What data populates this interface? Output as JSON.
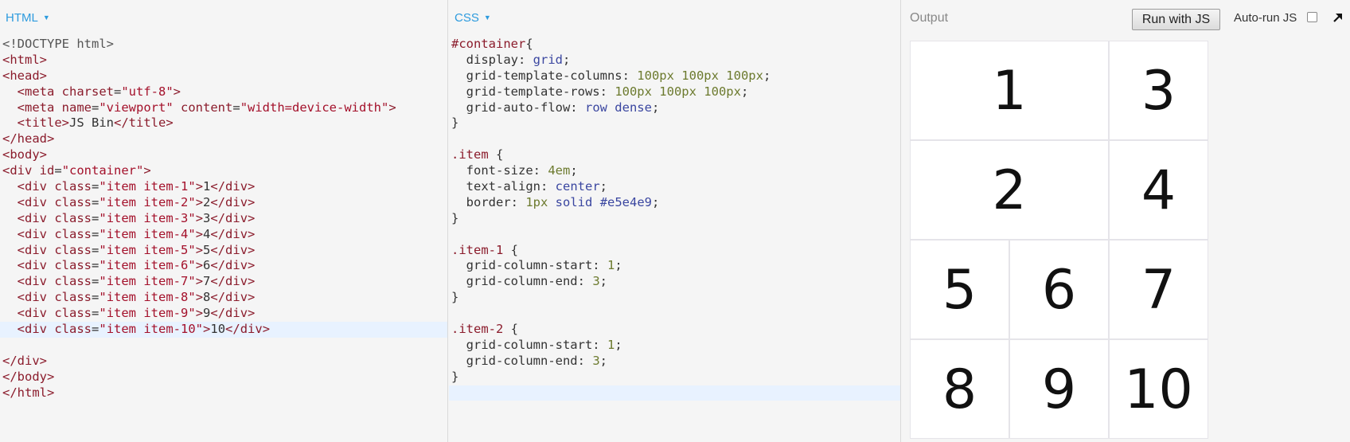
{
  "html_panel": {
    "label": "HTML",
    "lines": [
      [
        [
          "t-doctype",
          "<!DOCTYPE html>"
        ]
      ],
      [
        [
          "t-tag",
          "<html>"
        ]
      ],
      [
        [
          "t-tag",
          "<head>"
        ]
      ],
      [
        [
          "t-text",
          "  "
        ],
        [
          "t-tag",
          "<meta "
        ],
        [
          "t-attr",
          "charset"
        ],
        [
          "t-punc",
          "="
        ],
        [
          "t-str",
          "\"utf-8\""
        ],
        [
          "t-tag",
          ">"
        ]
      ],
      [
        [
          "t-text",
          "  "
        ],
        [
          "t-tag",
          "<meta "
        ],
        [
          "t-attr",
          "name"
        ],
        [
          "t-punc",
          "="
        ],
        [
          "t-str",
          "\"viewport\""
        ],
        [
          "t-text",
          " "
        ],
        [
          "t-attr",
          "content"
        ],
        [
          "t-punc",
          "="
        ],
        [
          "t-str",
          "\"width=device-width\""
        ],
        [
          "t-tag",
          ">"
        ]
      ],
      [
        [
          "t-text",
          "  "
        ],
        [
          "t-tag",
          "<title>"
        ],
        [
          "t-text",
          "JS Bin"
        ],
        [
          "t-tag",
          "</title>"
        ]
      ],
      [
        [
          "t-tag",
          "</head>"
        ]
      ],
      [
        [
          "t-tag",
          "<body>"
        ]
      ],
      [
        [
          "t-tag",
          "<div "
        ],
        [
          "t-attr",
          "id"
        ],
        [
          "t-punc",
          "="
        ],
        [
          "t-str",
          "\"container\""
        ],
        [
          "t-tag",
          ">"
        ]
      ],
      [
        [
          "t-text",
          "  "
        ],
        [
          "t-tag",
          "<div "
        ],
        [
          "t-attr",
          "class"
        ],
        [
          "t-punc",
          "="
        ],
        [
          "t-str",
          "\"item item-1\""
        ],
        [
          "t-tag",
          ">"
        ],
        [
          "t-text",
          "1"
        ],
        [
          "t-tag",
          "</div>"
        ]
      ],
      [
        [
          "t-text",
          "  "
        ],
        [
          "t-tag",
          "<div "
        ],
        [
          "t-attr",
          "class"
        ],
        [
          "t-punc",
          "="
        ],
        [
          "t-str",
          "\"item item-2\""
        ],
        [
          "t-tag",
          ">"
        ],
        [
          "t-text",
          "2"
        ],
        [
          "t-tag",
          "</div>"
        ]
      ],
      [
        [
          "t-text",
          "  "
        ],
        [
          "t-tag",
          "<div "
        ],
        [
          "t-attr",
          "class"
        ],
        [
          "t-punc",
          "="
        ],
        [
          "t-str",
          "\"item item-3\""
        ],
        [
          "t-tag",
          ">"
        ],
        [
          "t-text",
          "3"
        ],
        [
          "t-tag",
          "</div>"
        ]
      ],
      [
        [
          "t-text",
          "  "
        ],
        [
          "t-tag",
          "<div "
        ],
        [
          "t-attr",
          "class"
        ],
        [
          "t-punc",
          "="
        ],
        [
          "t-str",
          "\"item item-4\""
        ],
        [
          "t-tag",
          ">"
        ],
        [
          "t-text",
          "4"
        ],
        [
          "t-tag",
          "</div>"
        ]
      ],
      [
        [
          "t-text",
          "  "
        ],
        [
          "t-tag",
          "<div "
        ],
        [
          "t-attr",
          "class"
        ],
        [
          "t-punc",
          "="
        ],
        [
          "t-str",
          "\"item item-5\""
        ],
        [
          "t-tag",
          ">"
        ],
        [
          "t-text",
          "5"
        ],
        [
          "t-tag",
          "</div>"
        ]
      ],
      [
        [
          "t-text",
          "  "
        ],
        [
          "t-tag",
          "<div "
        ],
        [
          "t-attr",
          "class"
        ],
        [
          "t-punc",
          "="
        ],
        [
          "t-str",
          "\"item item-6\""
        ],
        [
          "t-tag",
          ">"
        ],
        [
          "t-text",
          "6"
        ],
        [
          "t-tag",
          "</div>"
        ]
      ],
      [
        [
          "t-text",
          "  "
        ],
        [
          "t-tag",
          "<div "
        ],
        [
          "t-attr",
          "class"
        ],
        [
          "t-punc",
          "="
        ],
        [
          "t-str",
          "\"item item-7\""
        ],
        [
          "t-tag",
          ">"
        ],
        [
          "t-text",
          "7"
        ],
        [
          "t-tag",
          "</div>"
        ]
      ],
      [
        [
          "t-text",
          "  "
        ],
        [
          "t-tag",
          "<div "
        ],
        [
          "t-attr",
          "class"
        ],
        [
          "t-punc",
          "="
        ],
        [
          "t-str",
          "\"item item-8\""
        ],
        [
          "t-tag",
          ">"
        ],
        [
          "t-text",
          "8"
        ],
        [
          "t-tag",
          "</div>"
        ]
      ],
      [
        [
          "t-text",
          "  "
        ],
        [
          "t-tag",
          "<div "
        ],
        [
          "t-attr",
          "class"
        ],
        [
          "t-punc",
          "="
        ],
        [
          "t-str",
          "\"item item-9\""
        ],
        [
          "t-tag",
          ">"
        ],
        [
          "t-text",
          "9"
        ],
        [
          "t-tag",
          "</div>"
        ]
      ],
      [
        [
          "t-text",
          "  "
        ],
        [
          "t-tag",
          "<div "
        ],
        [
          "t-attr",
          "class"
        ],
        [
          "t-punc",
          "="
        ],
        [
          "t-str",
          "\"item item-10\""
        ],
        [
          "t-tag",
          ">"
        ],
        [
          "t-text",
          "10"
        ],
        [
          "t-tag",
          "</div>"
        ]
      ],
      [
        [
          "t-text",
          ""
        ]
      ],
      [
        [
          "t-tag",
          "</div>"
        ]
      ],
      [
        [
          "t-tag",
          "</body>"
        ]
      ],
      [
        [
          "t-tag",
          "</html>"
        ]
      ]
    ],
    "active_line": 18
  },
  "css_panel": {
    "label": "CSS",
    "lines": [
      [
        [
          "t-sel",
          "#container"
        ],
        [
          "t-punc",
          "{"
        ]
      ],
      [
        [
          "t-prop",
          "  display: "
        ],
        [
          "t-val",
          "grid"
        ],
        [
          "t-punc",
          ";"
        ]
      ],
      [
        [
          "t-prop",
          "  grid-template-columns: "
        ],
        [
          "t-num",
          "100px 100px 100px"
        ],
        [
          "t-punc",
          ";"
        ]
      ],
      [
        [
          "t-prop",
          "  grid-template-rows: "
        ],
        [
          "t-num",
          "100px 100px 100px"
        ],
        [
          "t-punc",
          ";"
        ]
      ],
      [
        [
          "t-prop",
          "  grid-auto-flow: "
        ],
        [
          "t-val",
          "row dense"
        ],
        [
          "t-punc",
          ";"
        ]
      ],
      [
        [
          "t-punc",
          "}"
        ]
      ],
      [
        [
          "t-text",
          ""
        ]
      ],
      [
        [
          "t-sel",
          ".item"
        ],
        [
          "t-punc",
          " {"
        ]
      ],
      [
        [
          "t-prop",
          "  font-size: "
        ],
        [
          "t-num",
          "4em"
        ],
        [
          "t-punc",
          ";"
        ]
      ],
      [
        [
          "t-prop",
          "  text-align: "
        ],
        [
          "t-val",
          "center"
        ],
        [
          "t-punc",
          ";"
        ]
      ],
      [
        [
          "t-prop",
          "  border: "
        ],
        [
          "t-num",
          "1px"
        ],
        [
          "t-text",
          " "
        ],
        [
          "t-val",
          "solid"
        ],
        [
          "t-text",
          " "
        ],
        [
          "t-val",
          "#e5e4e9"
        ],
        [
          "t-punc",
          ";"
        ]
      ],
      [
        [
          "t-punc",
          "}"
        ]
      ],
      [
        [
          "t-text",
          ""
        ]
      ],
      [
        [
          "t-sel",
          ".item-1"
        ],
        [
          "t-punc",
          " {"
        ]
      ],
      [
        [
          "t-prop",
          "  grid-column-start: "
        ],
        [
          "t-num",
          "1"
        ],
        [
          "t-punc",
          ";"
        ]
      ],
      [
        [
          "t-prop",
          "  grid-column-end: "
        ],
        [
          "t-num",
          "3"
        ],
        [
          "t-punc",
          ";"
        ]
      ],
      [
        [
          "t-punc",
          "}"
        ]
      ],
      [
        [
          "t-text",
          ""
        ]
      ],
      [
        [
          "t-sel",
          ".item-2"
        ],
        [
          "t-punc",
          " {"
        ]
      ],
      [
        [
          "t-prop",
          "  grid-column-start: "
        ],
        [
          "t-num",
          "1"
        ],
        [
          "t-punc",
          ";"
        ]
      ],
      [
        [
          "t-prop",
          "  grid-column-end: "
        ],
        [
          "t-num",
          "3"
        ],
        [
          "t-punc",
          ";"
        ]
      ],
      [
        [
          "t-punc",
          "}"
        ]
      ],
      [
        [
          "t-text",
          ""
        ]
      ]
    ],
    "active_line": 22
  },
  "output_panel": {
    "label": "Output",
    "run_button": "Run with JS",
    "autorun_label": "Auto-run JS",
    "autorun_checked": false,
    "items": [
      "1",
      "3",
      "2",
      "4",
      "5",
      "6",
      "7",
      "8",
      "9",
      "10"
    ]
  }
}
